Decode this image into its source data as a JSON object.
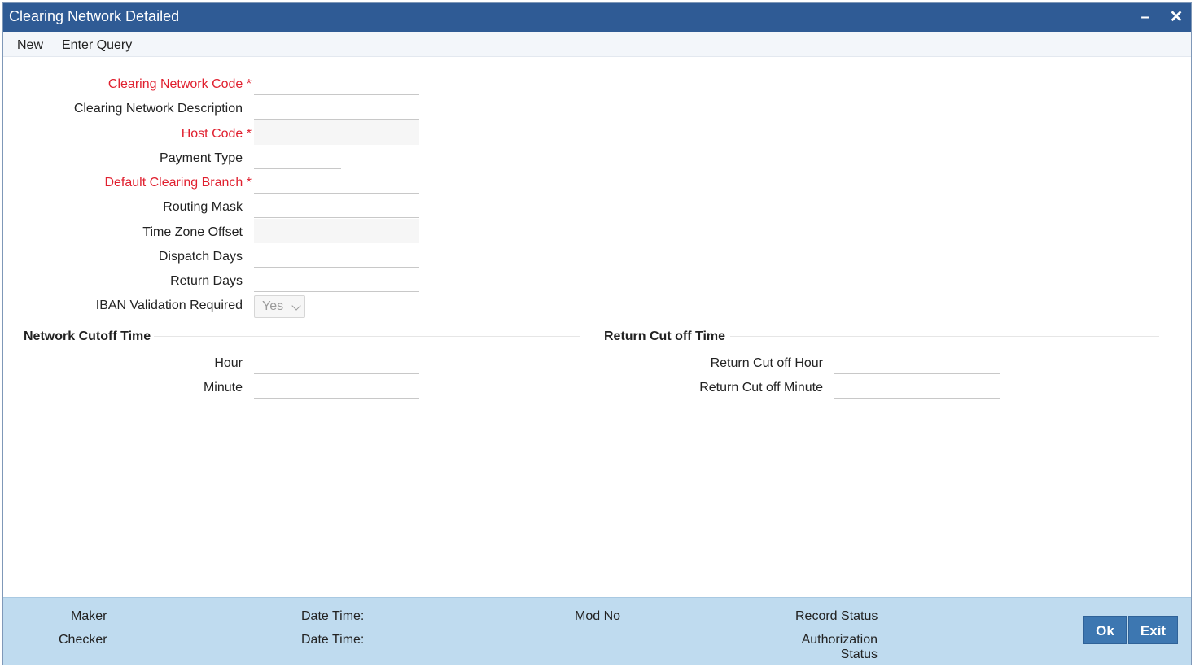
{
  "window": {
    "title": "Clearing Network Detailed"
  },
  "menu": {
    "new": "New",
    "enter_query": "Enter Query"
  },
  "form": {
    "clearing_network_code": "Clearing Network Code",
    "clearing_network_description": "Clearing Network Description",
    "host_code": "Host Code",
    "payment_type": "Payment Type",
    "default_clearing_branch": "Default Clearing Branch",
    "routing_mask": "Routing Mask",
    "time_zone_offset": "Time Zone Offset",
    "dispatch_days": "Dispatch Days",
    "return_days": "Return Days",
    "iban_validation_required": "IBAN Validation Required",
    "iban_validation_value": "Yes",
    "required_marker": "*"
  },
  "network_cutoff": {
    "title": "Network Cutoff Time",
    "hour": "Hour",
    "minute": "Minute"
  },
  "return_cutoff": {
    "title": "Return Cut off Time",
    "hour": "Return Cut off Hour",
    "minute": "Return Cut off Minute"
  },
  "footer": {
    "maker": "Maker",
    "checker": "Checker",
    "date_time_1": "Date Time:",
    "date_time_2": "Date Time:",
    "mod_no": "Mod No",
    "record_status": "Record Status",
    "authorization_status_line1": "Authorization",
    "authorization_status_line2": "Status",
    "ok": "Ok",
    "exit": "Exit"
  },
  "colors": {
    "titlebar": "#2f5b95",
    "required": "#e0202f",
    "footer": "#bfdbef",
    "button": "#3d77b1"
  }
}
